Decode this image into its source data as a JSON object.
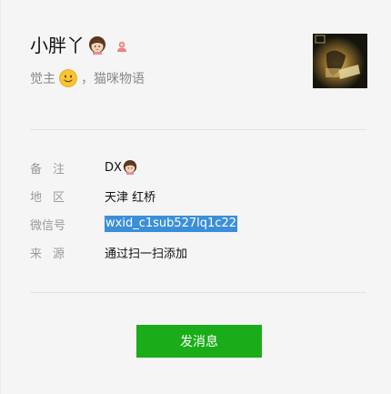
{
  "profile": {
    "nickname": "小胖丫",
    "signature_prefix": "觉主",
    "signature_suffix": "，猫咪物语",
    "avatar_icon": "avatar-photo",
    "gender_icon": "female-gender-icon",
    "gender_color": "#e8857f"
  },
  "info": {
    "remark_label": "备注",
    "remark_value": "DX",
    "region_label": "地区",
    "region_value": "天津 红桥",
    "wechat_id_label": "微信号",
    "wechat_id_value": "wxid_c1sub527lq1c22",
    "source_label": "来源",
    "source_value": "通过扫一扫添加"
  },
  "actions": {
    "send_message_label": "发消息",
    "accent_color": "#1aad19"
  }
}
